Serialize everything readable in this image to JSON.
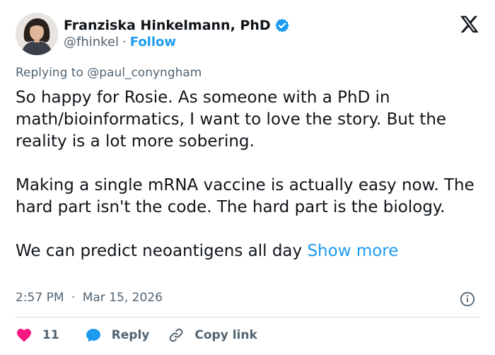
{
  "author": {
    "name": "Franziska Hinkelmann, PhD",
    "handle": "@fhinkel",
    "separator": "·",
    "follow_label": "Follow"
  },
  "reply": {
    "prefix": "Replying to",
    "mention": "@paul_conyngham"
  },
  "tweet": {
    "paragraphs": [
      "So happy for Rosie. As someone with a PhD in math/bioinformatics, I want to love the story. But the reality is a lot more sobering.",
      "Making a single mRNA vaccine is actually easy now. The hard part isn't the code. The hard part is the biology.",
      "We can predict neoantigens all day"
    ],
    "show_more": "Show more"
  },
  "meta": {
    "time": "2:57 PM",
    "separator": "·",
    "date": "Mar 15, 2026"
  },
  "actions": {
    "likes": "11",
    "reply_label": "Reply",
    "copy_link_label": "Copy link"
  },
  "colors": {
    "accent": "#1d9bf0",
    "like": "#f91880",
    "text": "#0f1419",
    "muted": "#536471"
  }
}
